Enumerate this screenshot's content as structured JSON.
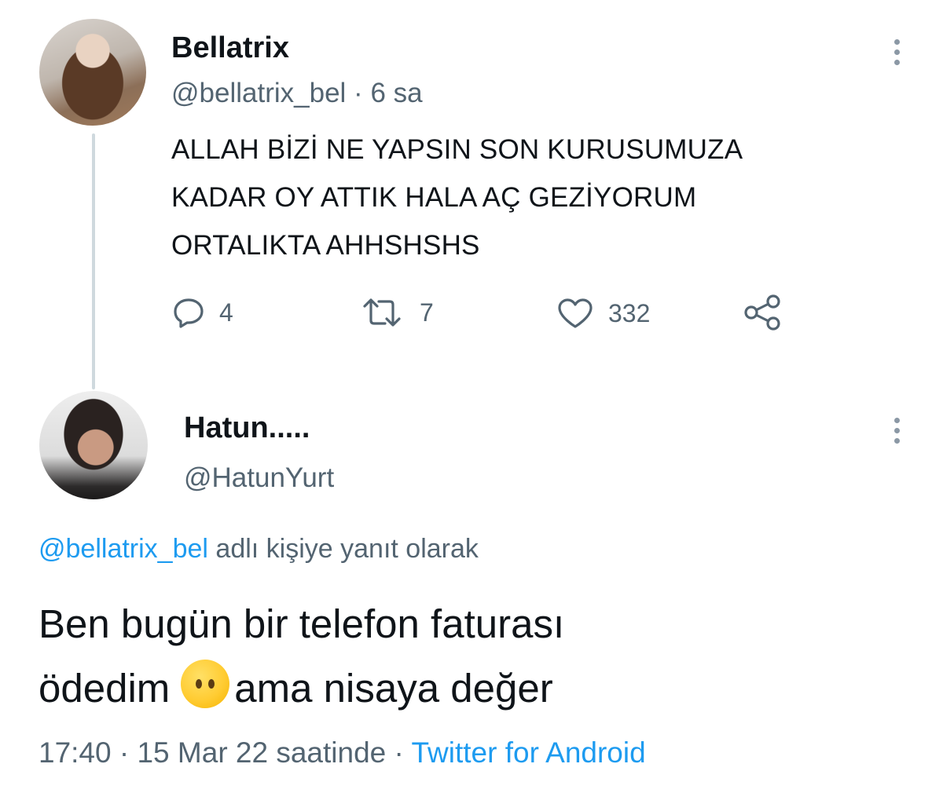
{
  "tweet1": {
    "name": "Bellatrix",
    "handle": "@bellatrix_bel",
    "separator": "·",
    "time": "6 sa",
    "lines": [
      "ALLAH BİZİ NE YAPSIN SON KURUSUMUZA",
      "KADAR OY ATTIK HALA AÇ GEZİYORUM",
      "ORTALIKTA AHHSHSHS"
    ],
    "replies": "4",
    "retweets": "7",
    "likes": "332"
  },
  "tweet2": {
    "name": "Hatun.....",
    "handle": "@HatunYurt",
    "reply_to_handle": "@bellatrix_bel",
    "reply_to_text": "adlı kişiye yanıt olarak",
    "line1": "Ben bugün bir telefon faturası",
    "line2_start": "ödedim",
    "line2_end": "ama nisaya değer",
    "time": "17:40",
    "separator": "·",
    "date": "15 Mar 22 saatinde",
    "separator2": "·",
    "source": "Twitter for Android"
  },
  "icons": {
    "reply": "reply-icon",
    "retweet": "retweet-icon",
    "like": "heart-icon",
    "share": "share-icon",
    "more": "more-icon",
    "emoji": "face-without-mouth-emoji"
  },
  "colors": {
    "accent": "#1d9bf0",
    "secondary_text": "#536471",
    "primary_text": "#0f1419"
  }
}
